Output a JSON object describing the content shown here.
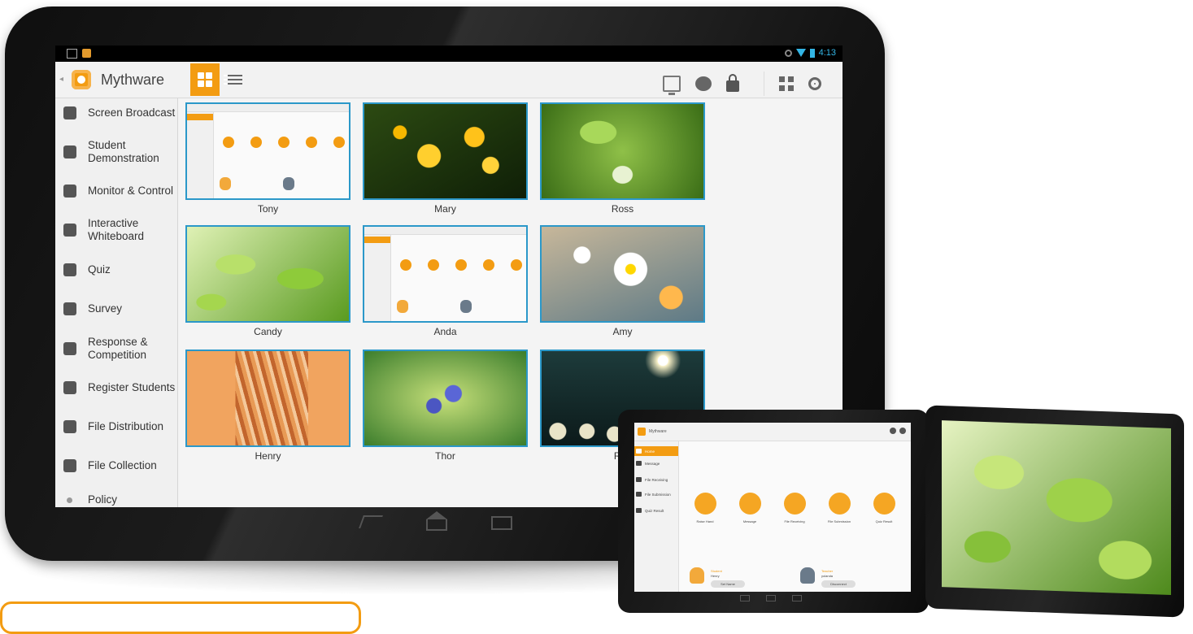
{
  "app": {
    "title": "Mythware",
    "status_time": "4:13",
    "colors": {
      "accent": "#f39c12",
      "thumb_border": "#2b98c9"
    }
  },
  "toolbar": {
    "view_grid_icon": "grid-view-icon",
    "view_list_icon": "list-view-icon",
    "actions": [
      "monitor-icon",
      "chat-icon",
      "lock-icon",
      "qr-code-icon",
      "gear-icon"
    ]
  },
  "sidebar": {
    "items": [
      {
        "label": "Screen Broadcast",
        "icon": "broadcast-icon"
      },
      {
        "label": "Student\nDemonstration",
        "icon": "demonstration-icon"
      },
      {
        "label": "Monitor & Control",
        "icon": "monitor-control-icon"
      },
      {
        "label": "Interactive\nWhiteboard",
        "icon": "whiteboard-icon"
      },
      {
        "label": "Quiz",
        "icon": "quiz-icon"
      },
      {
        "label": "Survey",
        "icon": "survey-icon"
      },
      {
        "label": "Response &\nCompetition",
        "icon": "response-icon"
      },
      {
        "label": "Register Students",
        "icon": "register-icon"
      },
      {
        "label": "File Distribution",
        "icon": "file-distribution-icon"
      },
      {
        "label": "File Collection",
        "icon": "file-collection-icon"
      },
      {
        "label": "Policy",
        "icon": "policy-icon"
      }
    ]
  },
  "students": [
    {
      "name": "Tony"
    },
    {
      "name": "Mary"
    },
    {
      "name": "Ross"
    },
    {
      "name": "Candy"
    },
    {
      "name": "Anda"
    },
    {
      "name": "Amy"
    },
    {
      "name": "Henry"
    },
    {
      "name": "Thor"
    },
    {
      "name": "Ray"
    }
  ],
  "student_app": {
    "title": "Mythware",
    "nav": [
      "Home",
      "Message",
      "File Receiving",
      "File Submission",
      "Quiz Result"
    ],
    "actions": [
      "Raise Hand",
      "Message",
      "File Receiving",
      "File Submission",
      "Quiz Result"
    ],
    "student_label": "Student",
    "student_name": "Henry",
    "student_button": "Set Name",
    "teacher_label": "Teacher",
    "teacher_name": "yolanda",
    "teacher_button": "Disconnect"
  }
}
